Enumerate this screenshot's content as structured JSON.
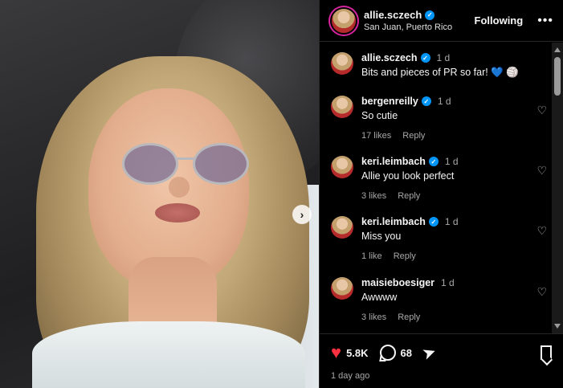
{
  "header": {
    "username": "allie.sczech",
    "location": "San Juan, Puerto Rico",
    "follow_label": "Following",
    "more_icon": "more-horizontal-icon"
  },
  "caption": {
    "username": "allie.sczech",
    "time": "1 d",
    "text": "Bits and pieces of PR so far! 💙 🏐"
  },
  "comments": [
    {
      "username": "bergenreilly",
      "verified": true,
      "time": "1 d",
      "text": "So cutie",
      "likes": "17 likes",
      "reply_label": "Reply"
    },
    {
      "username": "keri.leimbach",
      "verified": true,
      "time": "1 d",
      "text": "Allie you look perfect",
      "likes": "3 likes",
      "reply_label": "Reply"
    },
    {
      "username": "keri.leimbach",
      "verified": true,
      "time": "1 d",
      "text": "Miss you",
      "likes": "1 like",
      "reply_label": "Reply"
    },
    {
      "username": "maisieboesiger",
      "verified": false,
      "time": "1 d",
      "text": "Awwww",
      "likes": "3 likes",
      "reply_label": "Reply"
    }
  ],
  "footer": {
    "likes": "5.8K",
    "comments": "68",
    "posted": "1 day ago"
  },
  "colors": {
    "accent_blue": "#0095f6",
    "like_red": "#ff3040",
    "background": "#000000"
  }
}
